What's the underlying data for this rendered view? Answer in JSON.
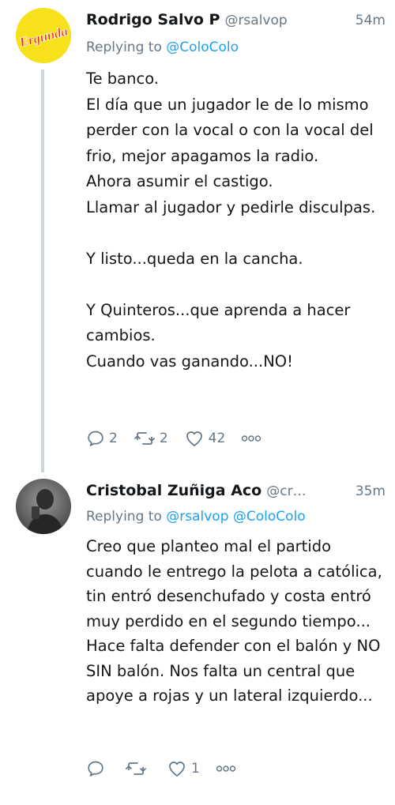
{
  "tweets": [
    {
      "author": "Rodrigo Salvo P",
      "handle": "@rsalvop",
      "time": "54m",
      "replying_prefix": "Replying to",
      "replying_to": [
        "@ColoColo"
      ],
      "avatar_logo_text": "Ergunda",
      "text": "Te banco.\nEl día que un jugador le de lo mismo perder con la vocal o con la vocal del frio, mejor apagamos la radio.\nAhora asumir el castigo.\nLlamar al jugador y pedirle disculpas.\n\nY listo...queda en la cancha.\n\nY Quinteros...que aprenda a hacer cambios.\nCuando vas ganando...NO!",
      "replies": "2",
      "retweets": "2",
      "likes": "42"
    },
    {
      "author": "Cristobal Zuñiga Aco",
      "handle": "@cr…",
      "time": "35m",
      "replying_prefix": "Replying to",
      "replying_to": [
        "@rsalvop",
        "@ColoColo"
      ],
      "text": "Creo que planteo mal el partido cuando le entrego la pelota a católica, tin entró desenchufado y costa entró muy perdido en el segundo tiempo... Hace falta defender con el balón y NO SIN balón. Nos falta un central que apoye a rojas y un lateral izquierdo...",
      "replies": "",
      "retweets": "",
      "likes": "1"
    }
  ],
  "icons": {
    "reply": "reply-icon",
    "retweet": "retweet-icon",
    "like": "heart-icon",
    "more": "more-icon"
  },
  "colors": {
    "link": "#1da1f2",
    "secondary_text": "#657786",
    "thread_line": "#ccd6dd",
    "logo_background": "#f7e11b",
    "logo_text": "#e3262e"
  }
}
